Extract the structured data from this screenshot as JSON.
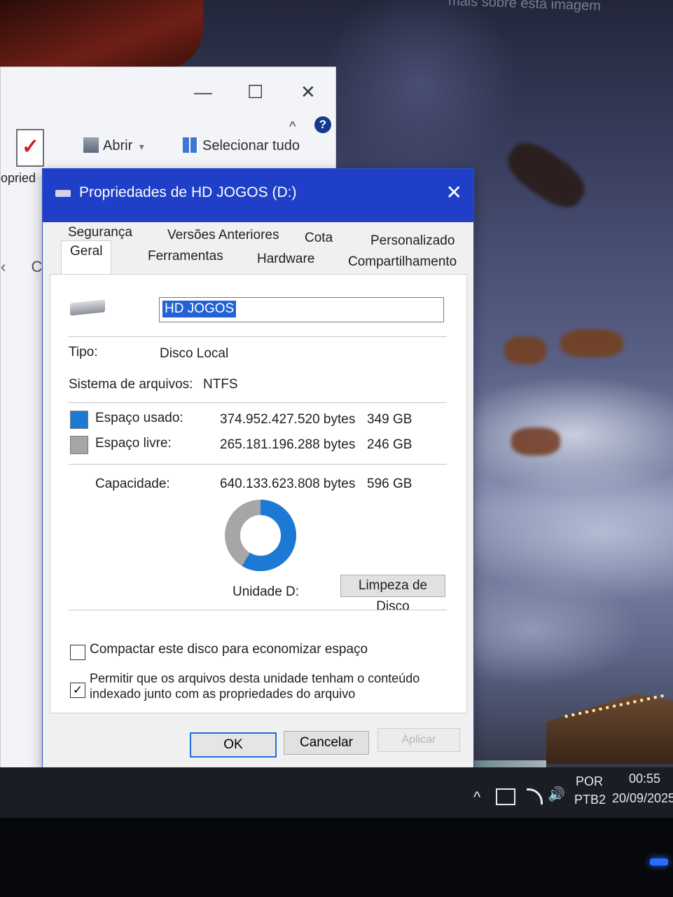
{
  "wallpaper": {
    "caption": "mais sobre esta imagem"
  },
  "explorer": {
    "minimize": "—",
    "maximize": "☐",
    "close": "✕",
    "chevron": "^",
    "help": "?",
    "ribbon": {
      "open_label": "Abrir",
      "open_arrow": "▾",
      "select_all_label": "Selecionar tudo",
      "properties_cut": "opried"
    },
    "nav": {
      "back": "‹",
      "refresh": "C"
    }
  },
  "dialog": {
    "title": "Propriedades de HD JOGOS (D:)",
    "close": "✕",
    "tabs_top": [
      "Segurança",
      "Versões Anteriores",
      "Cota",
      "Personalizado"
    ],
    "tabs_bottom": [
      "Geral",
      "Ferramentas",
      "Hardware",
      "Compartilhamento"
    ],
    "active_tab": "Geral",
    "name_value": "HD JOGOS",
    "type_label": "Tipo:",
    "type_value": "Disco Local",
    "fs_label": "Sistema de arquivos:",
    "fs_value": "NTFS",
    "used": {
      "label": "Espaço usado:",
      "bytes": "374.952.427.520 bytes",
      "size": "349 GB",
      "color": "#1c7ad4"
    },
    "free": {
      "label": "Espaço livre:",
      "bytes": "265.181.196.288 bytes",
      "size": "246 GB",
      "color": "#a6a6a6"
    },
    "capacity": {
      "label": "Capacidade:",
      "bytes": "640.133.623.808 bytes",
      "size": "596 GB"
    },
    "used_fraction": 0.586,
    "drive_label": "Unidade D:",
    "cleanup_button": "Limpeza de Disco",
    "compress_label": "Compactar este disco para economizar espaço",
    "compress_checked": false,
    "index_label_line1": "Permitir que os arquivos desta unidade tenham o conteúdo",
    "index_label_line2": "indexado junto com as propriedades do arquivo",
    "index_checked": true,
    "check_mark": "✓",
    "ok": "OK",
    "cancel": "Cancelar",
    "apply": "Aplicar"
  },
  "taskbar": {
    "tray_chevron": "^",
    "language": "POR",
    "layout": "PTB2",
    "time": "00:55",
    "date": "20/09/2025",
    "volume_icon": "🔊"
  }
}
